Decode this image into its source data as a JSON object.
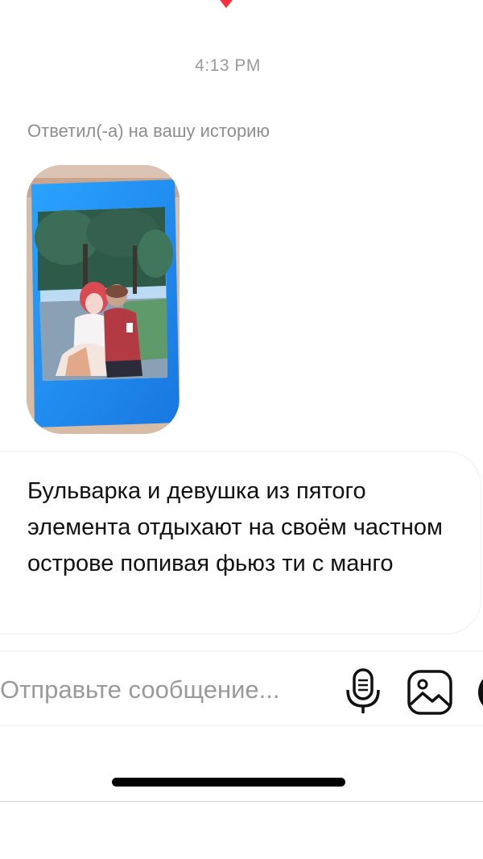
{
  "chat": {
    "timestamp": "4:13 PM",
    "story_reply_label": "Ответил(-а) на вашу историю",
    "story_image_name": "instax photo of two people in a park",
    "message_text": "Бульварка и девушка из пятого элемента отдыхают на своём частном острове попивая фьюз ти с манго"
  },
  "composer": {
    "placeholder": "Отправьте сообщение...",
    "value": ""
  },
  "icons": {
    "top": "heart-icon",
    "mic": "microphone-icon",
    "gallery": "gallery-icon",
    "sticker": "sticker-icon"
  },
  "colors": {
    "heart": "#ff2d3d",
    "timestamp": "#9a9a9a",
    "secondary_text": "#8e8e8e",
    "photo_frame": "#1f8ff0"
  }
}
